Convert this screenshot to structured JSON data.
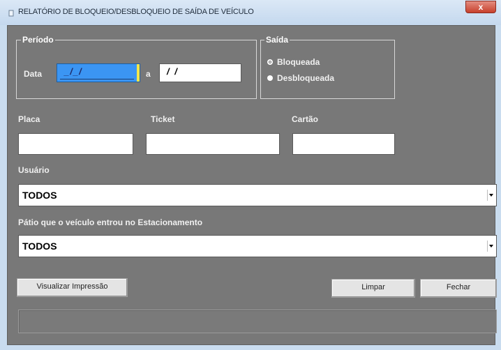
{
  "window": {
    "title": "RELATÓRIO DE BLOQUEIO/DESBLOQUEIO DE SAÍDA DE VEÍCULO",
    "close_glyph": "x"
  },
  "periodo": {
    "legend": "Período",
    "data_label": "Data",
    "from_value": "_/_/",
    "separator": "a",
    "to_value": "/ /"
  },
  "saida": {
    "legend": "Saída",
    "options": [
      {
        "label": "Bloqueada",
        "checked": true
      },
      {
        "label": "Desbloqueada",
        "checked": false
      }
    ]
  },
  "fields": {
    "placa_label": "Placa",
    "ticket_label": "Ticket",
    "cartao_label": "Cartão",
    "placa_value": "",
    "ticket_value": "",
    "cartao_value": ""
  },
  "usuario": {
    "label": "Usuário",
    "value": "TODOS"
  },
  "patio": {
    "label": "Pátio que o veículo entrou no Estacionamento",
    "value": "TODOS"
  },
  "buttons": {
    "preview": "Visualizar Impressão",
    "clear": "Limpar",
    "close": "Fechar"
  },
  "status_text": "",
  "colors": {
    "client_bg": "#787878",
    "date_highlight": "#3b95f3",
    "close_button": "#c7402c"
  }
}
